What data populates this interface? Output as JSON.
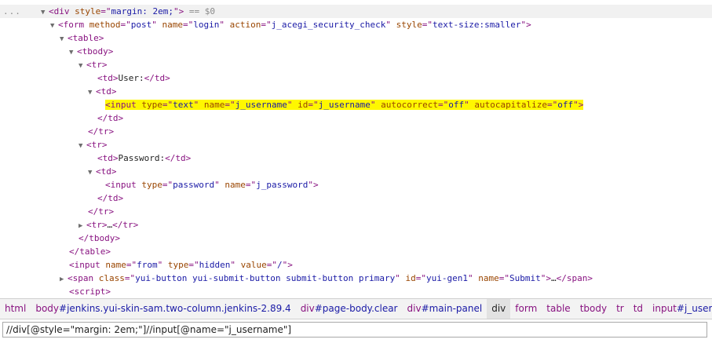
{
  "tree": {
    "top_gutter": "...",
    "selected_suffix": "== $0",
    "rows": [
      {
        "kind": "open",
        "arrow": "▼",
        "tag": "div",
        "attrs": [
          {
            "n": "style",
            "v": "margin: 2em;"
          }
        ],
        "suffix": " == $0",
        "selected": true
      },
      {
        "kind": "open",
        "arrow": "▼",
        "tag": "form",
        "attrs": [
          {
            "n": "method",
            "v": "post"
          },
          {
            "n": "name",
            "v": "login"
          },
          {
            "n": "action",
            "v": "j_acegi_security_check"
          },
          {
            "n": "style",
            "v": "text-size:smaller"
          }
        ]
      },
      {
        "kind": "open",
        "arrow": "▼",
        "tag": "table",
        "attrs": []
      },
      {
        "kind": "open",
        "arrow": "▼",
        "tag": "tbody",
        "attrs": []
      },
      {
        "kind": "open",
        "arrow": "▼",
        "tag": "tr",
        "attrs": []
      },
      {
        "kind": "td-text",
        "tag": "td",
        "text": "User:"
      },
      {
        "kind": "open",
        "arrow": "▼",
        "tag": "td",
        "attrs": []
      },
      {
        "kind": "selfclose",
        "tag": "input",
        "attrs": [
          {
            "n": "type",
            "v": "text"
          },
          {
            "n": "name",
            "v": "j_username"
          },
          {
            "n": "id",
            "v": "j_username"
          },
          {
            "n": "autocorrect",
            "v": "off"
          },
          {
            "n": "autocapitalize",
            "v": "off"
          }
        ],
        "highlight": true
      },
      {
        "kind": "close",
        "tag": "td"
      },
      {
        "kind": "close",
        "tag": "tr"
      },
      {
        "kind": "open",
        "arrow": "▼",
        "tag": "tr",
        "attrs": []
      },
      {
        "kind": "td-text",
        "tag": "td",
        "text": "Password:"
      },
      {
        "kind": "open",
        "arrow": "▼",
        "tag": "td",
        "attrs": []
      },
      {
        "kind": "selfclose",
        "tag": "input",
        "attrs": [
          {
            "n": "type",
            "v": "password"
          },
          {
            "n": "name",
            "v": "j_password"
          }
        ]
      },
      {
        "kind": "close",
        "tag": "td"
      },
      {
        "kind": "close",
        "tag": "tr"
      },
      {
        "kind": "collapsed",
        "arrow": "▶",
        "tag": "tr",
        "ellipsis": "…"
      },
      {
        "kind": "close",
        "tag": "tbody"
      },
      {
        "kind": "close",
        "tag": "table"
      },
      {
        "kind": "selfclose",
        "tag": "input",
        "attrs": [
          {
            "n": "name",
            "v": "from"
          },
          {
            "n": "type",
            "v": "hidden"
          },
          {
            "n": "value",
            "v": "/"
          }
        ]
      },
      {
        "kind": "collapsed",
        "arrow": "▶",
        "tag": "span",
        "attrs": [
          {
            "n": "class",
            "v": "yui-button yui-submit-button submit-button primary"
          },
          {
            "n": "id",
            "v": "yui-gen1"
          },
          {
            "n": "name",
            "v": "Submit"
          }
        ],
        "ellipsis": "…"
      },
      {
        "kind": "open-bare",
        "tag": "script",
        "attrs": []
      }
    ]
  },
  "breadcrumbs": [
    {
      "tag": "html",
      "extra": ""
    },
    {
      "tag": "body",
      "extra": "#jenkins.yui-skin-sam.two-column.jenkins-2.89.4"
    },
    {
      "tag": "div",
      "extra": "#page-body.clear"
    },
    {
      "tag": "div",
      "extra": "#main-panel"
    },
    {
      "tag": "div",
      "extra": "",
      "active": true
    },
    {
      "tag": "form",
      "extra": ""
    },
    {
      "tag": "table",
      "extra": ""
    },
    {
      "tag": "tbody",
      "extra": ""
    },
    {
      "tag": "tr",
      "extra": ""
    },
    {
      "tag": "td",
      "extra": ""
    },
    {
      "tag": "input",
      "extra": "#j_username"
    }
  ],
  "search": {
    "value": "//div[@style=\"margin: 2em;\"]//input[@name=\"j_username\"]"
  }
}
